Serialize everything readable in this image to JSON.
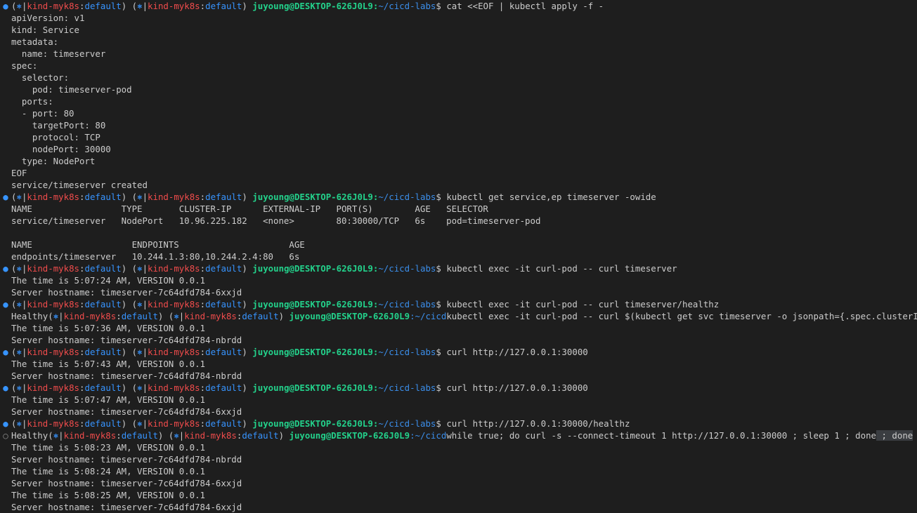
{
  "prompt": {
    "open": "(",
    "k8s_icon": "⎈",
    "sep": "|",
    "context": "kind-myk8s",
    "colon": ":",
    "namespace": "default",
    "close": ")",
    "user_host": "juyoung@DESKTOP-626J0L9",
    "cwd_sep": ":",
    "cwd": "~/cicd-labs",
    "cwd_trunc": "~/cicd",
    "dollar": "$"
  },
  "lines": [
    {
      "kind": "prompt",
      "mark": "done",
      "cmd": " cat <<EOF | kubectl apply -f -"
    },
    {
      "kind": "out",
      "text": "apiVersion: v1"
    },
    {
      "kind": "out",
      "text": "kind: Service"
    },
    {
      "kind": "out",
      "text": "metadata:"
    },
    {
      "kind": "out",
      "text": "  name: timeserver"
    },
    {
      "kind": "out",
      "text": "spec:"
    },
    {
      "kind": "out",
      "text": "  selector:"
    },
    {
      "kind": "out",
      "text": "    pod: timeserver-pod"
    },
    {
      "kind": "out",
      "text": "  ports:"
    },
    {
      "kind": "out",
      "text": "  - port: 80"
    },
    {
      "kind": "out",
      "text": "    targetPort: 80"
    },
    {
      "kind": "out",
      "text": "    protocol: TCP"
    },
    {
      "kind": "out",
      "text": "    nodePort: 30000"
    },
    {
      "kind": "out",
      "text": "  type: NodePort"
    },
    {
      "kind": "out",
      "text": "EOF"
    },
    {
      "kind": "out",
      "text": "service/timeserver created"
    },
    {
      "kind": "prompt",
      "mark": "done",
      "cmd": " kubectl get service,ep timeserver -owide"
    },
    {
      "kind": "out",
      "text": "NAME                 TYPE       CLUSTER-IP      EXTERNAL-IP   PORT(S)        AGE   SELECTOR"
    },
    {
      "kind": "out",
      "text": "service/timeserver   NodePort   10.96.225.182   <none>        80:30000/TCP   6s    pod=timeserver-pod"
    },
    {
      "kind": "out",
      "text": ""
    },
    {
      "kind": "out",
      "text": "NAME                   ENDPOINTS                     AGE"
    },
    {
      "kind": "out",
      "text": "endpoints/timeserver   10.244.1.3:80,10.244.2.4:80   6s"
    },
    {
      "kind": "prompt",
      "mark": "done",
      "cmd": " kubectl exec -it curl-pod -- curl timeserver"
    },
    {
      "kind": "out",
      "text": "The time is 5:07:24 AM, VERSION 0.0.1"
    },
    {
      "kind": "out",
      "text": "Server hostname: timeserver-7c64dfd784-6xxjd"
    },
    {
      "kind": "prompt",
      "mark": "done",
      "cmd": " kubectl exec -it curl-pod -- curl timeserver/healthz"
    },
    {
      "kind": "prompt-healthy",
      "lead": "Healthy",
      "cmd": "kubectl exec -it curl-pod -- curl $(kubectl get svc timeserver -o jsonpath={.spec.clusterIP})",
      "tail": "terIP})"
    },
    {
      "kind": "out",
      "text": "The time is 5:07:36 AM, VERSION 0.0.1"
    },
    {
      "kind": "out",
      "text": "Server hostname: timeserver-7c64dfd784-nbrdd"
    },
    {
      "kind": "prompt",
      "mark": "done",
      "cmd": " curl http://127.0.0.1:30000"
    },
    {
      "kind": "out",
      "text": "The time is 5:07:43 AM, VERSION 0.0.1"
    },
    {
      "kind": "out",
      "text": "Server hostname: timeserver-7c64dfd784-nbrdd"
    },
    {
      "kind": "prompt",
      "mark": "done",
      "cmd": " curl http://127.0.0.1:30000"
    },
    {
      "kind": "out",
      "text": "The time is 5:07:47 AM, VERSION 0.0.1"
    },
    {
      "kind": "out",
      "text": "Server hostname: timeserver-7c64dfd784-6xxjd"
    },
    {
      "kind": "prompt",
      "mark": "done",
      "cmd": " curl http://127.0.0.1:30000/healthz"
    },
    {
      "kind": "prompt-healthy",
      "lead": "Healthy",
      "mark": "run",
      "cmd": "while true; do curl -s --connect-timeout 1 http://127.0.0.1:30000 ; sleep 1 ; done",
      "tail": " ; done"
    },
    {
      "kind": "out",
      "text": "The time is 5:08:23 AM, VERSION 0.0.1"
    },
    {
      "kind": "out",
      "text": "Server hostname: timeserver-7c64dfd784-nbrdd"
    },
    {
      "kind": "out",
      "text": "The time is 5:08:24 AM, VERSION 0.0.1"
    },
    {
      "kind": "out",
      "text": "Server hostname: timeserver-7c64dfd784-6xxjd"
    },
    {
      "kind": "out",
      "text": "The time is 5:08:25 AM, VERSION 0.0.1"
    },
    {
      "kind": "out",
      "text": "Server hostname: timeserver-7c64dfd784-6xxjd"
    }
  ],
  "icons": {
    "done": "circle-filled-icon",
    "run": "circle-outline-icon",
    "k8s": "helm-wheel-icon"
  },
  "colors": {
    "background": "#1e1e1e",
    "context": "#f14c4c",
    "accent": "#3794ff",
    "user": "#23d18b"
  }
}
